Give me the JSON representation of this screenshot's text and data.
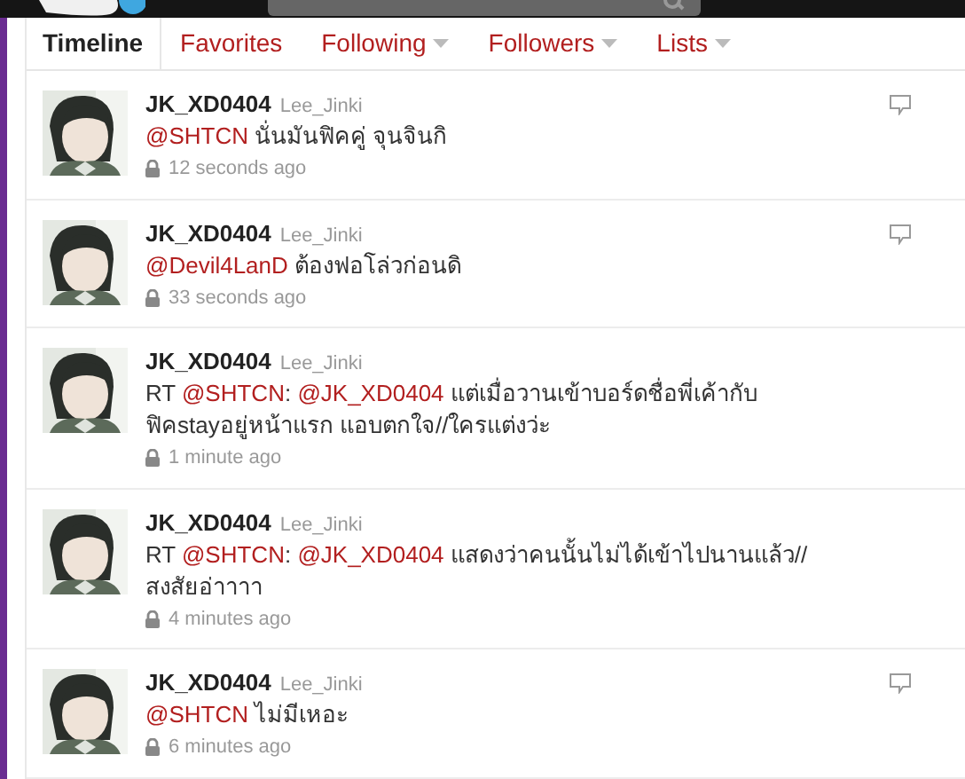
{
  "tabs": [
    {
      "label": "Timeline",
      "selected": true,
      "dropdown": false
    },
    {
      "label": "Favorites",
      "selected": false,
      "dropdown": false
    },
    {
      "label": "Following",
      "selected": false,
      "dropdown": true
    },
    {
      "label": "Followers",
      "selected": false,
      "dropdown": true
    },
    {
      "label": "Lists",
      "selected": false,
      "dropdown": true
    }
  ],
  "tweets": [
    {
      "username": "JK_XD0404",
      "name": "Lee_Jinki",
      "text": [
        {
          "kind": "mention",
          "text": "@SHTCN"
        },
        {
          "kind": "text",
          "text": " นั่นมันฟิคคู่ จุนจินกิ"
        }
      ],
      "time": "12 seconds ago",
      "reply_icon": true
    },
    {
      "username": "JK_XD0404",
      "name": "Lee_Jinki",
      "text": [
        {
          "kind": "mention",
          "text": "@Devil4LanD"
        },
        {
          "kind": "text",
          "text": " ต้องฟอโล่วก่อนดิ"
        }
      ],
      "time": "33 seconds ago",
      "reply_icon": true
    },
    {
      "username": "JK_XD0404",
      "name": "Lee_Jinki",
      "text": [
        {
          "kind": "text",
          "text": "RT "
        },
        {
          "kind": "mention",
          "text": "@SHTCN"
        },
        {
          "kind": "text",
          "text": ": "
        },
        {
          "kind": "mention",
          "text": "@JK_XD0404"
        },
        {
          "kind": "text",
          "text": " แต่เมื่อวานเข้าบอร์ดชื่อพี่เค้ากับฟิคstayอยู่หน้าแรก แอบตกใจ//ใครแต่งว่ะ"
        }
      ],
      "time": "1 minute ago",
      "reply_icon": false
    },
    {
      "username": "JK_XD0404",
      "name": "Lee_Jinki",
      "text": [
        {
          "kind": "text",
          "text": "RT "
        },
        {
          "kind": "mention",
          "text": "@SHTCN"
        },
        {
          "kind": "text",
          "text": ": "
        },
        {
          "kind": "mention",
          "text": "@JK_XD0404"
        },
        {
          "kind": "text",
          "text": " แสดงว่าคนนั้นไม่ได้เข้าไปนานแล้ว// สงสัยอ่าาาา"
        }
      ],
      "time": "4 minutes ago",
      "reply_icon": false
    },
    {
      "username": "JK_XD0404",
      "name": "Lee_Jinki",
      "text": [
        {
          "kind": "mention",
          "text": "@SHTCN"
        },
        {
          "kind": "text",
          "text": " ไม่มีเหอะ"
        }
      ],
      "time": "6 minutes ago",
      "reply_icon": true
    }
  ]
}
